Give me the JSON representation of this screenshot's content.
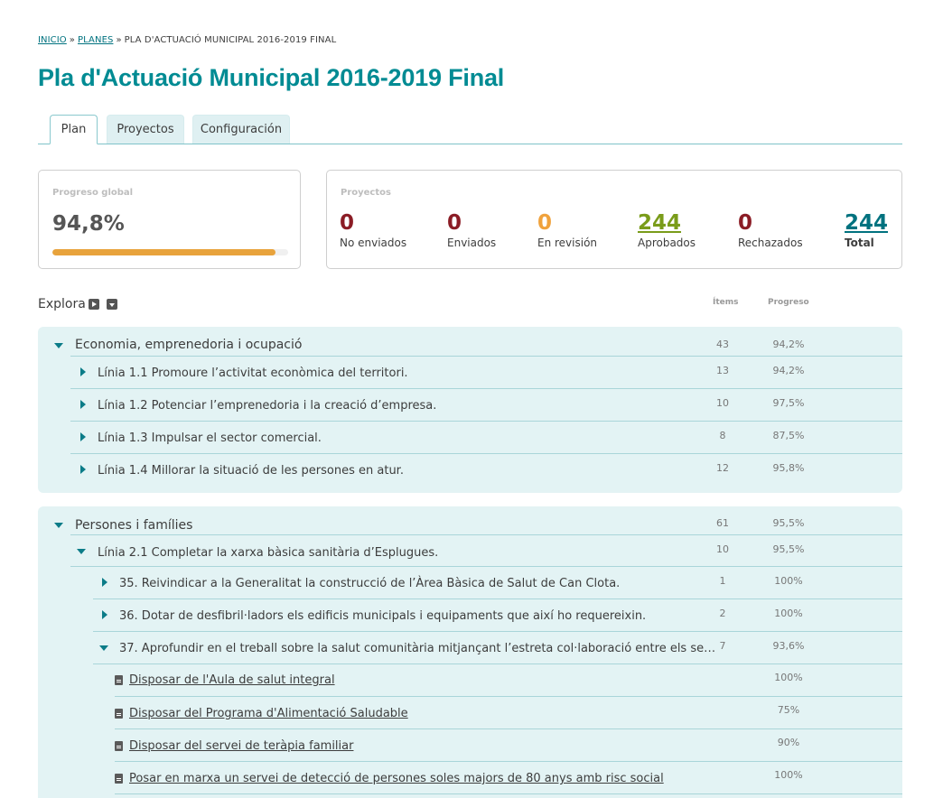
{
  "breadcrumb": {
    "home": "INICIO",
    "sep1": "»",
    "plans": "PLANES",
    "sep2": "»",
    "current": "PLA D'ACTUACIÓ MUNICIPAL 2016-2019 FINAL"
  },
  "title": "Pla d'Actuació Municipal 2016-2019 Final",
  "tabs": [
    {
      "label": "Plan",
      "active": true
    },
    {
      "label": "Proyectos",
      "active": false
    },
    {
      "label": "Configuración",
      "active": false
    }
  ],
  "progress_card": {
    "label": "Progreso global",
    "value": "94,8%",
    "fraction": 0.948,
    "bar_color": "#e8a33c"
  },
  "projects_card": {
    "label": "Proyectos",
    "stats": [
      {
        "value": "0",
        "label": "No enviados",
        "color": "#8b1c25"
      },
      {
        "value": "0",
        "label": "Enviados",
        "color": "#8b1c25"
      },
      {
        "value": "0",
        "label": "En revisión",
        "color": "#f0a23c"
      },
      {
        "value": "244",
        "label": "Aprobados",
        "color": "#7a9c1a"
      },
      {
        "value": "0",
        "label": "Rechazados",
        "color": "#8b1c25"
      },
      {
        "value": "244",
        "label": "Total",
        "color": "#00727f"
      }
    ]
  },
  "explore": {
    "label": "Explora",
    "col_items": "Ítems",
    "col_progress": "Progreso",
    "expand_icon": "caret-right-square-icon",
    "collapse_icon": "caret-down-square-icon"
  },
  "groups": [
    {
      "title": "Economia, emprenedoria i ocupació",
      "items": "43",
      "progress": "94,2%",
      "lines": [
        {
          "text": "Línia 1.1 Promoure l’activitat econòmica del territori.",
          "items": "13",
          "progress": "94,2%"
        },
        {
          "text": "Línia 1.2 Potenciar l’emprenedoria i la creació d’empresa.",
          "items": "10",
          "progress": "97,5%"
        },
        {
          "text": "Línia 1.3 Impulsar el sector comercial.",
          "items": "8",
          "progress": "87,5%"
        },
        {
          "text": "Línia 1.4 Millorar la situació de les persones en atur.",
          "items": "12",
          "progress": "95,8%"
        }
      ]
    },
    {
      "title": "Persones i famílies",
      "items": "61",
      "progress": "95,5%",
      "line": {
        "text": "Línia 2.1 Completar la xarxa bàsica sanitària d’Esplugues.",
        "items": "10",
        "progress": "95,5%"
      },
      "actions": [
        {
          "text": "35. Reivindicar a la Generalitat la construcció de l’Àrea Bàsica de Salut de Can Clota.",
          "items": "1",
          "progress": "100%"
        },
        {
          "text": "36. Dotar de desfibril·ladors els edificis municipals i equipaments que així ho requereixin.",
          "items": "2",
          "progress": "100%"
        },
        {
          "text": "37. Aprofundir en el treball sobre la salut comunitària mitjançant l’estreta col·laboració entre els se…",
          "items": "7",
          "progress": "93,6%"
        }
      ],
      "projects": [
        {
          "text": "Disposar de l'Aula de salut integral",
          "progress": "100%"
        },
        {
          "text": "Disposar del Programa d'Alimentació Saludable",
          "progress": "75%"
        },
        {
          "text": "Disposar del servei de teràpia familiar",
          "progress": "90%"
        },
        {
          "text": "Posar en marxa un servei de detecció de persones soles majors de 80 anys amb risc social",
          "progress": "100%"
        }
      ]
    }
  ]
}
